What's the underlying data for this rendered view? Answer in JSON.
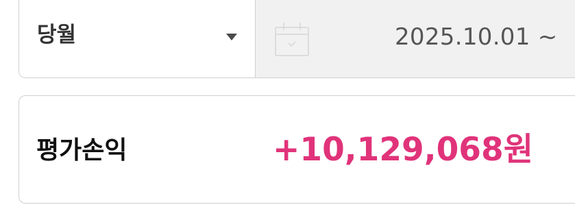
{
  "filter": {
    "period_label": "당월",
    "date_range": "2025.10.01 ~"
  },
  "summary": {
    "label": "평가손익",
    "value": "+10,129,068원",
    "value_color": "#e0337a"
  },
  "icons": {
    "dropdown": "triangle-down-icon",
    "calendar": "calendar-icon"
  }
}
